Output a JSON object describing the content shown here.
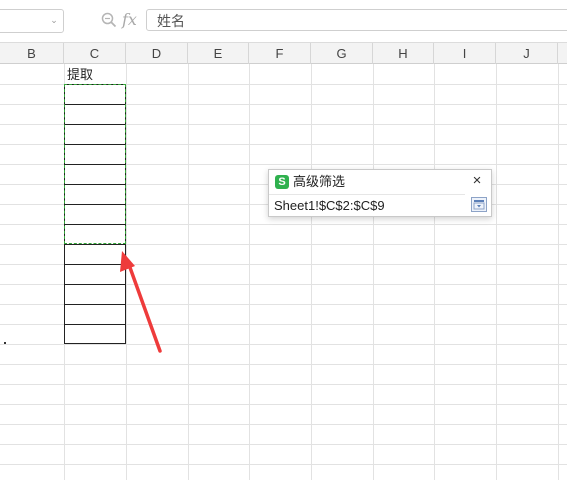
{
  "formula_bar": {
    "name_box_value": "",
    "fx_label": "fx",
    "formula_value": "姓名"
  },
  "columns": [
    "B",
    "C",
    "D",
    "E",
    "F",
    "G",
    "H",
    "I",
    "J"
  ],
  "cells": {
    "c2": "提取"
  },
  "dialog": {
    "icon_letter": "S",
    "title": "高级筛选",
    "close_symbol": "×",
    "range_value": "Sheet1!$C$2:$C$9"
  },
  "colors": {
    "marquee": "#35a83a",
    "arrow": "#ee3b3b",
    "app_icon": "#2fb14e"
  }
}
